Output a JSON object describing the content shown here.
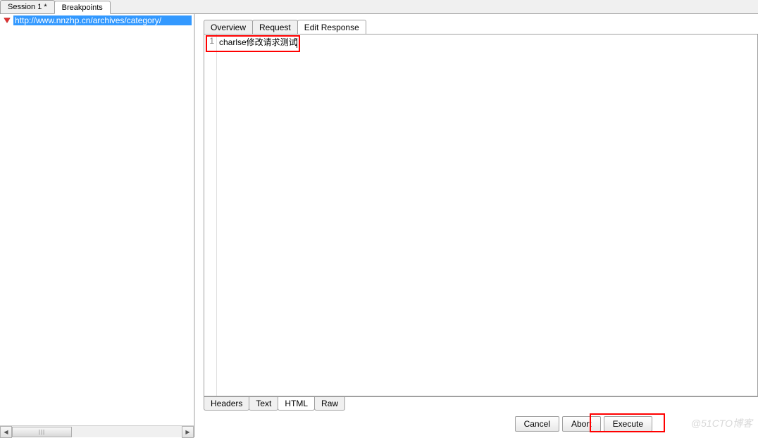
{
  "top_tabs": {
    "session": "Session 1 *",
    "breakpoints": "Breakpoints"
  },
  "sidebar": {
    "url_item": "http://www.nnzhp.cn/archives/category/"
  },
  "sub_tabs": {
    "overview": "Overview",
    "request": "Request",
    "edit_response": "Edit Response"
  },
  "editor": {
    "line_number": "1",
    "content": "charlse修改请求测试"
  },
  "bottom_tabs": {
    "headers": "Headers",
    "text": "Text",
    "html": "HTML",
    "raw": "Raw"
  },
  "actions": {
    "cancel": "Cancel",
    "abort": "Abort",
    "execute": "Execute"
  },
  "watermark": "@51CTO博客"
}
